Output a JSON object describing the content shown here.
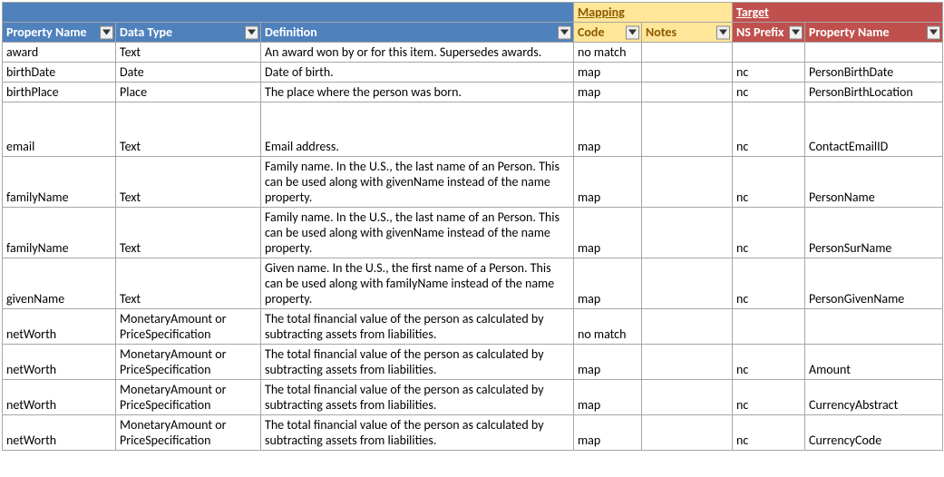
{
  "groupHeaders": {
    "mapping": "Mapping",
    "target": "Target"
  },
  "columns": {
    "propertyName": "Property Name",
    "dataType": "Data Type",
    "definition": "Definition",
    "code": "Code",
    "notes": "Notes",
    "nsPrefix": "NS Prefix",
    "targetPropertyName": "Property Name"
  },
  "rows": [
    {
      "propertyName": "award",
      "dataType": "Text",
      "definition": "An award won by or for this item. Supersedes awards.",
      "code": "no match",
      "notes": "",
      "nsPrefix": "",
      "targetPropertyName": ""
    },
    {
      "propertyName": "birthDate",
      "dataType": "Date",
      "definition": "Date of birth.",
      "code": "map",
      "notes": "",
      "nsPrefix": "nc",
      "targetPropertyName": "PersonBirthDate"
    },
    {
      "propertyName": "birthPlace",
      "dataType": "Place",
      "definition": "The place where the person was born.",
      "code": "map",
      "notes": "",
      "nsPrefix": "nc",
      "targetPropertyName": "PersonBirthLocation"
    },
    {
      "propertyName": "email",
      "dataType": "Text",
      "definition": "Email address.",
      "code": "map",
      "notes": "",
      "nsPrefix": "nc",
      "targetPropertyName": "ContactEmailID",
      "tall": true
    },
    {
      "propertyName": "familyName",
      "dataType": "Text",
      "definition": "Family name. In the U.S., the last name of an Person. This can be used along with givenName instead of the name property.",
      "code": "map",
      "notes": "",
      "nsPrefix": "nc",
      "targetPropertyName": "PersonName"
    },
    {
      "propertyName": "familyName",
      "dataType": "Text",
      "definition": "Family name. In the U.S., the last name of an Person. This can be used along with givenName instead of the name property.",
      "code": "map",
      "notes": "",
      "nsPrefix": "nc",
      "targetPropertyName": "PersonSurName"
    },
    {
      "propertyName": "givenName",
      "dataType": "Text",
      "definition": "Given name. In the U.S., the first name of a Person. This can be used along with familyName instead of the name property.",
      "code": "map",
      "notes": "",
      "nsPrefix": "nc",
      "targetPropertyName": "PersonGivenName"
    },
    {
      "propertyName": "netWorth",
      "dataType": "MonetaryAmount or PriceSpecification",
      "definition": "The total financial value of the person as calculated by subtracting assets from liabilities.",
      "code": "no match",
      "notes": "",
      "nsPrefix": "",
      "targetPropertyName": ""
    },
    {
      "propertyName": "netWorth",
      "dataType": "MonetaryAmount or PriceSpecification",
      "definition": "The total financial value of the person as calculated by subtracting assets from liabilities.",
      "code": "map",
      "notes": "",
      "nsPrefix": "nc",
      "targetPropertyName": "Amount"
    },
    {
      "propertyName": "netWorth",
      "dataType": "MonetaryAmount or PriceSpecification",
      "definition": "The total financial value of the person as calculated by subtracting assets from liabilities.",
      "code": "map",
      "notes": "",
      "nsPrefix": "nc",
      "targetPropertyName": "CurrencyAbstract"
    },
    {
      "propertyName": "netWorth",
      "dataType": "MonetaryAmount or PriceSpecification",
      "definition": "The total financial value of the person as calculated by subtracting assets from liabilities.",
      "code": "map",
      "notes": "",
      "nsPrefix": "nc",
      "targetPropertyName": "CurrencyCode"
    }
  ]
}
